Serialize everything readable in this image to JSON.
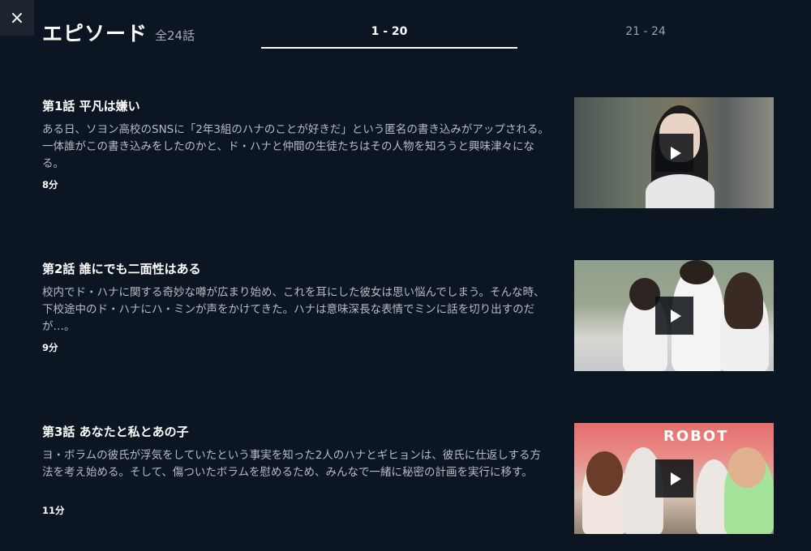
{
  "header": {
    "close_icon": "×",
    "title": "エピソード",
    "count": "全24話"
  },
  "tabs": [
    {
      "label": "1 - 20",
      "active": true
    },
    {
      "label": "21 - 24",
      "active": false
    }
  ],
  "episodes": [
    {
      "title": "第1話 平凡は嫌い",
      "description": "ある日、ソヨン高校のSNSに「2年3組のハナのことが好きだ」という匿名の書き込みがアップされる。一体誰がこの書き込みをしたのかと、ド・ハナと仲間の生徒たちはその人物を知ろうと興味津々になる。",
      "duration": "8分"
    },
    {
      "title": "第2話 誰にでも二面性はある",
      "description": "校内でド・ハナに関する奇妙な噂が広まり始め、これを耳にした彼女は思い悩んでしまう。そんな時、下校途中のド・ハナにハ・ミンが声をかけてきた。ハナは意味深長な表情でミンに話を切り出すのだが…。",
      "duration": "9分"
    },
    {
      "title": "第3話 あなたと私とあの子",
      "description": "ヨ・ボラムの彼氏が浮気をしていたという事実を知った2人のハナとギヒョンは、彼氏に仕返しする方法を考え始める。そして、傷ついたボラムを慰めるため、みんなで一緒に秘密の計画を実行に移す。",
      "duration": "11分",
      "thumb_text": "ROBOT"
    }
  ]
}
